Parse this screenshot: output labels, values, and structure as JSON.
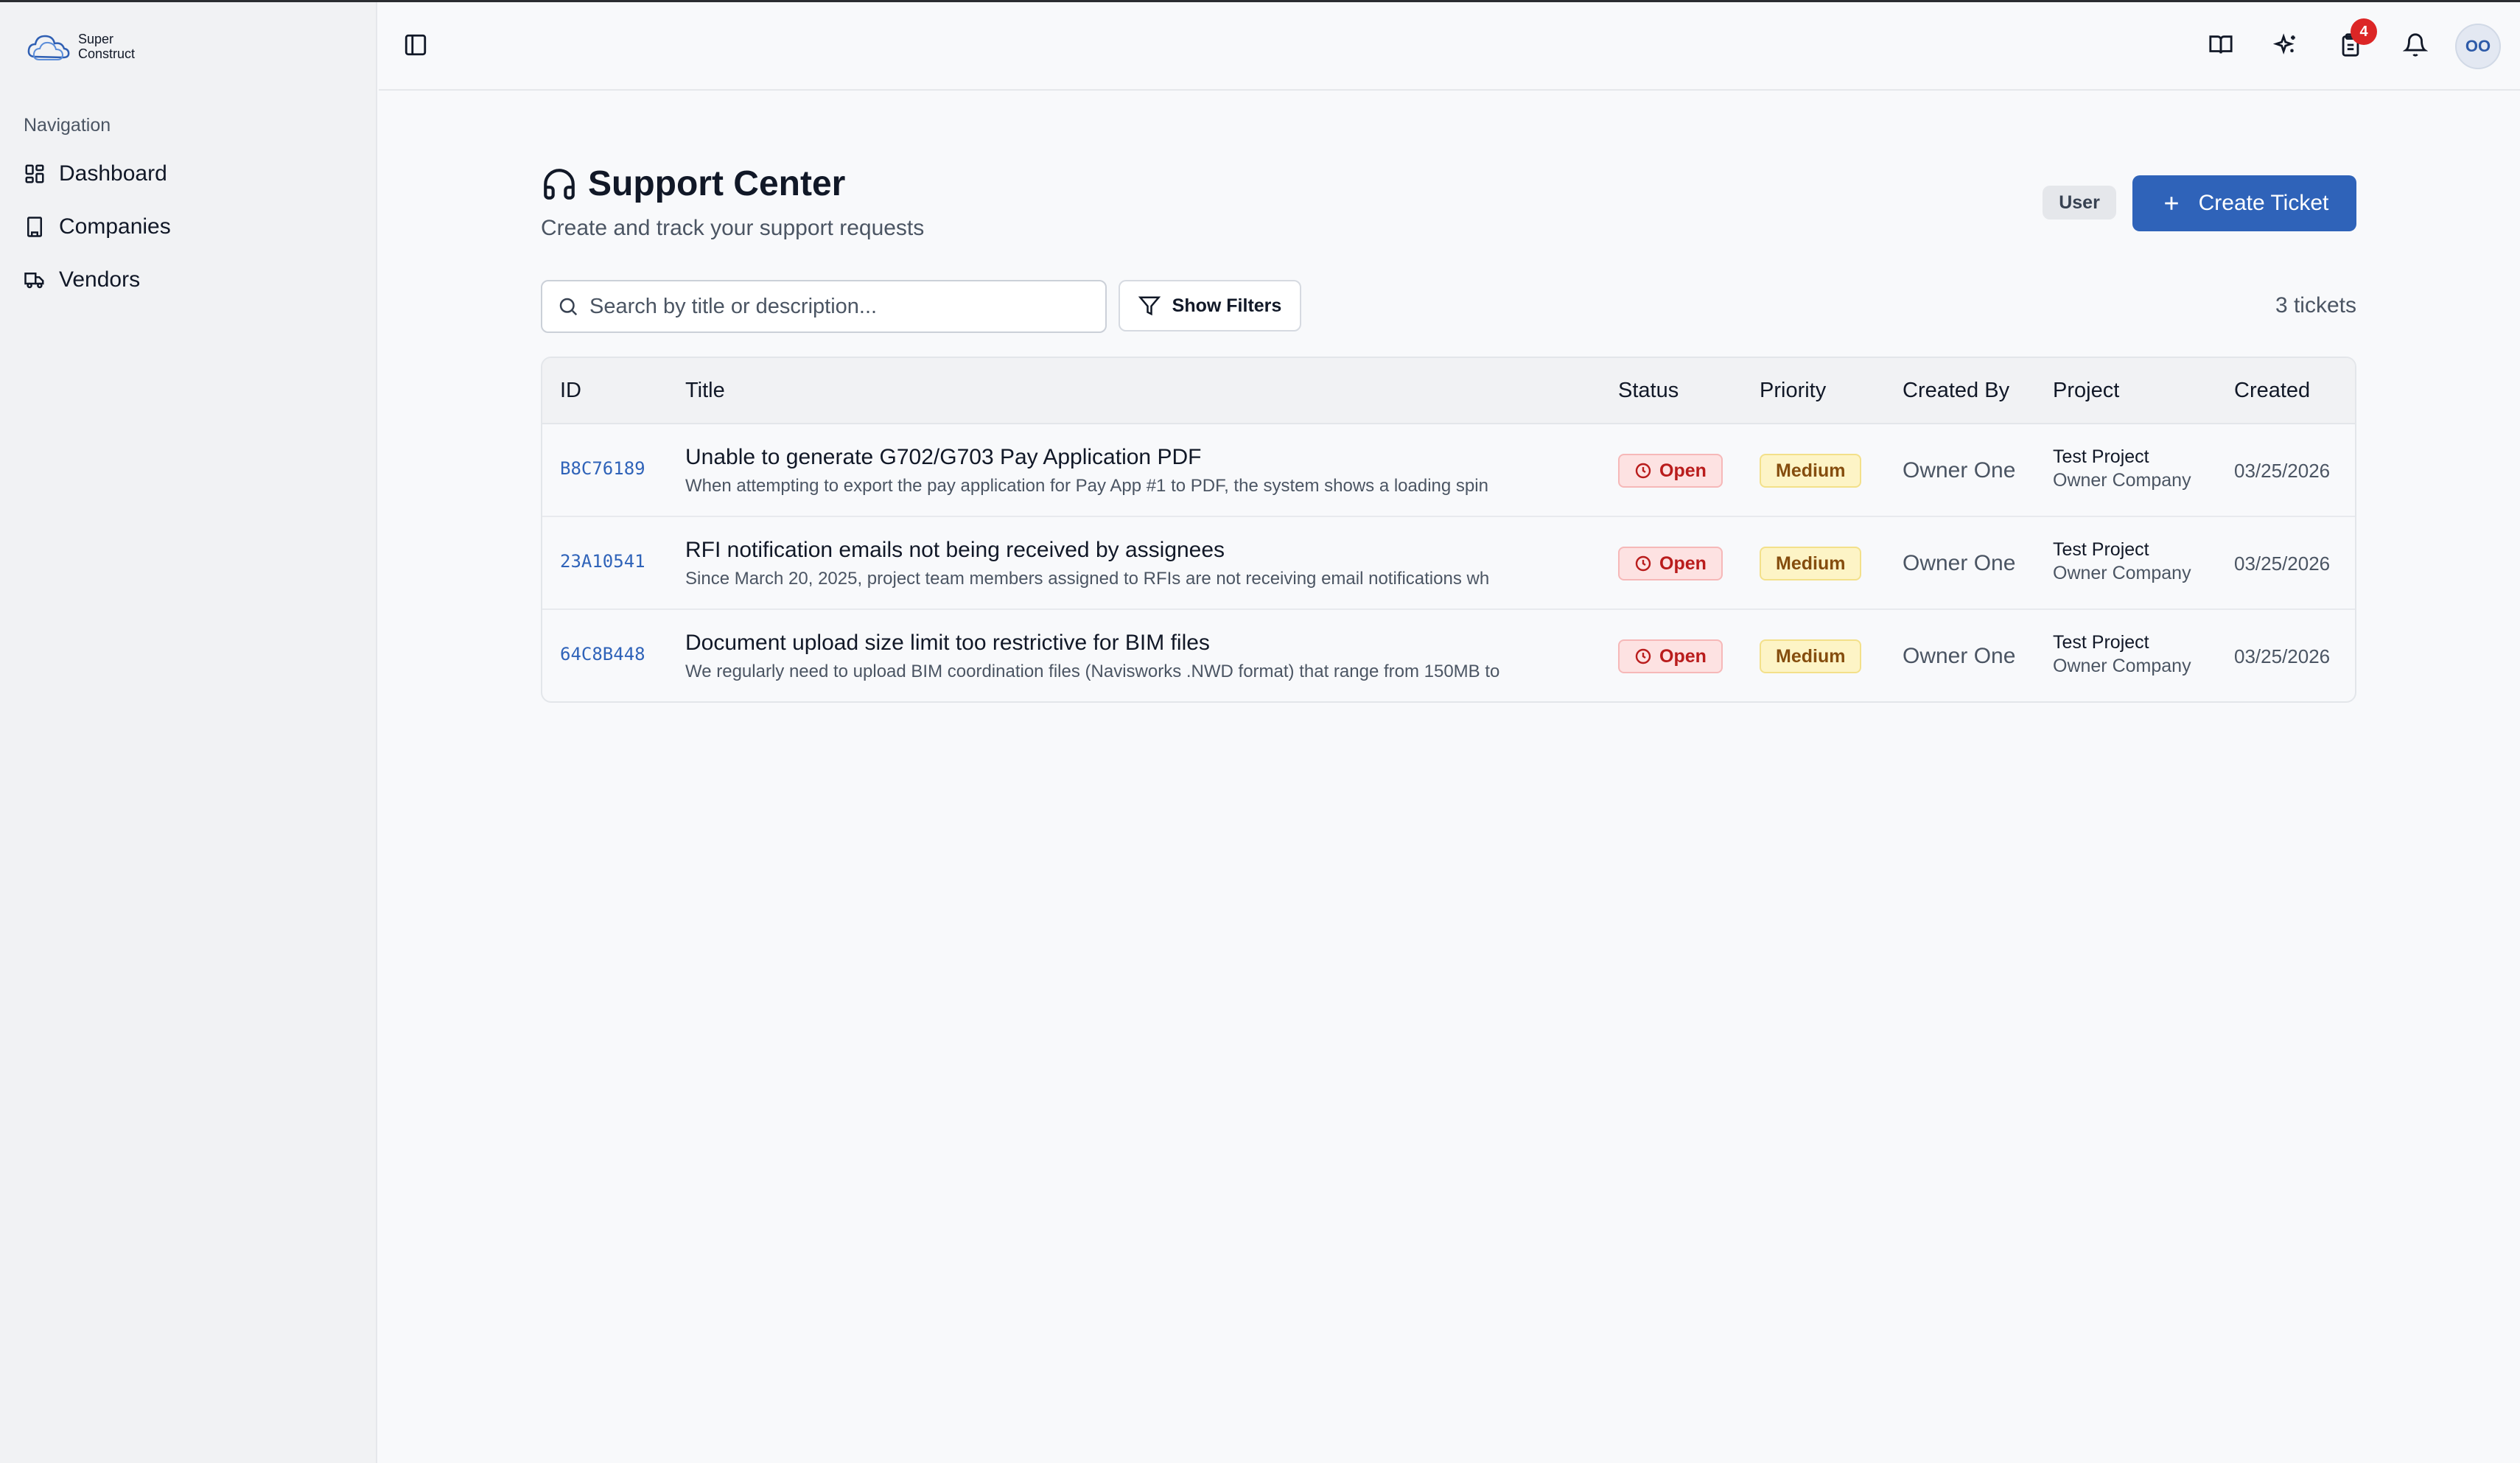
{
  "app": {
    "logo_line1": "Super",
    "logo_line2": "Construct"
  },
  "sidebar": {
    "heading": "Navigation",
    "items": [
      {
        "label": "Dashboard",
        "icon": "dashboard-icon"
      },
      {
        "label": "Companies",
        "icon": "building-icon"
      },
      {
        "label": "Vendors",
        "icon": "truck-icon"
      }
    ]
  },
  "header": {
    "icons": [
      "sidebar-toggle-icon",
      "book-icon",
      "sparkles-icon",
      "clipboard-icon",
      "bell-icon"
    ],
    "clipboard_badge": "4",
    "avatar_initials": "OO"
  },
  "page": {
    "title": "Support Center",
    "subtitle": "Create and track your support requests",
    "role_badge": "User",
    "create_button": "Create Ticket",
    "search_placeholder": "Search by title or description...",
    "filters_button": "Show Filters",
    "ticket_count": "3 tickets"
  },
  "table": {
    "columns": [
      "ID",
      "Title",
      "Status",
      "Priority",
      "Created By",
      "Project",
      "Created"
    ],
    "rows": [
      {
        "id": "B8C76189",
        "title": "Unable to generate G702/G703 Pay Application PDF",
        "description": "When attempting to export the pay application for Pay App #1 to PDF, the system shows a loading spin",
        "status": "Open",
        "priority": "Medium",
        "created_by": "Owner One",
        "project": "Test Project",
        "company": "Owner Company",
        "created": "03/25/2026"
      },
      {
        "id": "23A10541",
        "title": "RFI notification emails not being received by assignees",
        "description": "Since March 20, 2025, project team members assigned to RFIs are not receiving email notifications wh",
        "status": "Open",
        "priority": "Medium",
        "created_by": "Owner One",
        "project": "Test Project",
        "company": "Owner Company",
        "created": "03/25/2026"
      },
      {
        "id": "64C8B448",
        "title": "Document upload size limit too restrictive for BIM files",
        "description": "We regularly need to upload BIM coordination files (Navisworks .NWD format) that range from 150MB to",
        "status": "Open",
        "priority": "Medium",
        "created_by": "Owner One",
        "project": "Test Project",
        "company": "Owner Company",
        "created": "03/25/2026"
      }
    ]
  },
  "colors": {
    "primary": "#2f63b9",
    "status_open_bg": "#fde2e2",
    "status_open_text": "#b91c1c",
    "priority_medium_bg": "#fdf4c6",
    "priority_medium_text": "#854d0e",
    "badge": "#dc2626"
  }
}
